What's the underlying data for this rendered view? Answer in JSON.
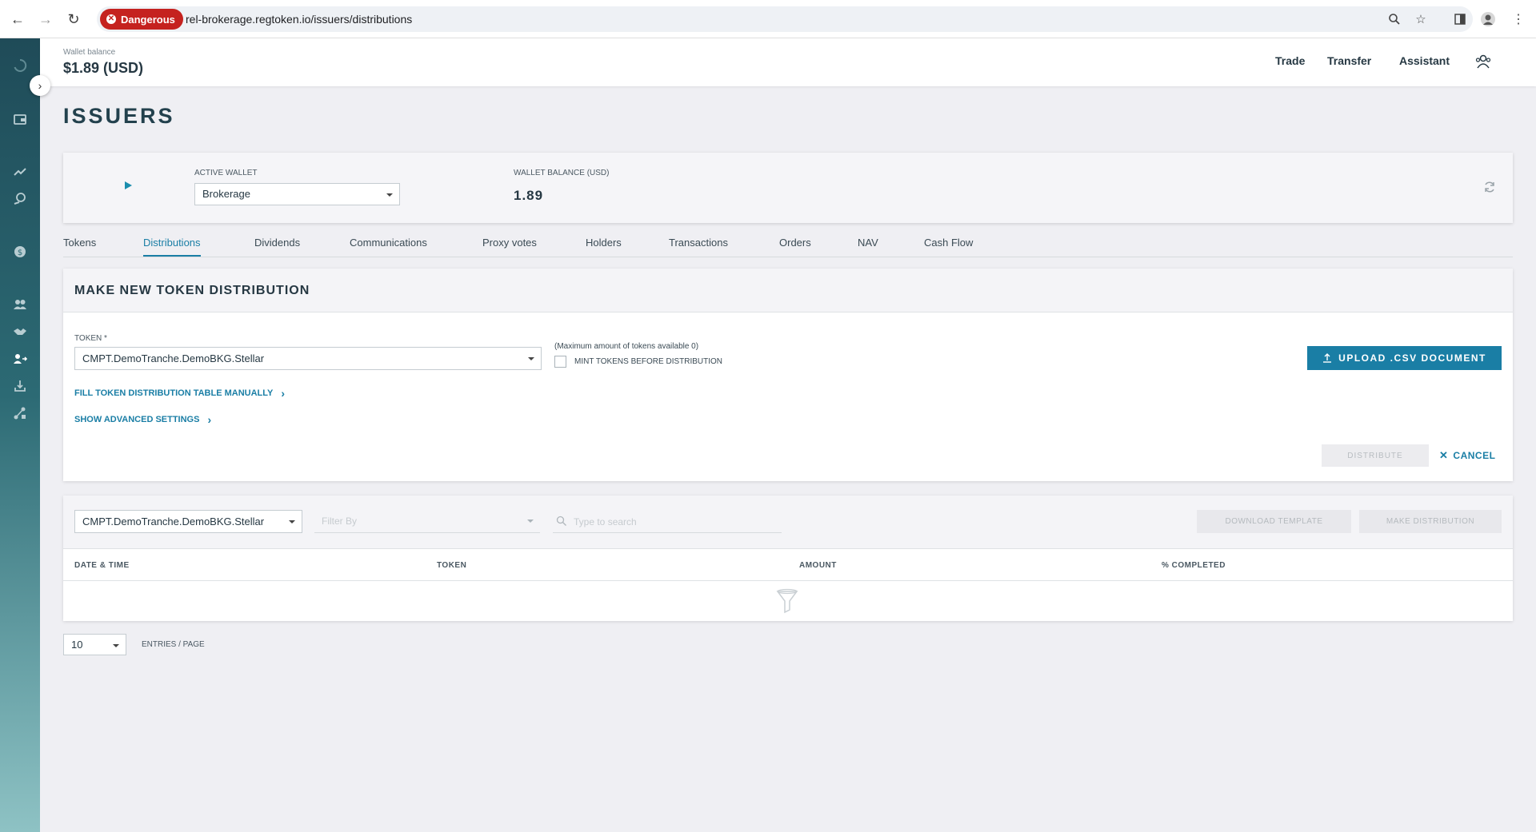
{
  "browser": {
    "security_chip": "Dangerous",
    "url": "rel-brokerage.regtoken.io/issuers/distributions"
  },
  "header": {
    "wallet_balance_label": "Wallet balance",
    "wallet_balance_value": "$1.89 (USD)",
    "links": [
      "Trade",
      "Transfer",
      "Assistant"
    ]
  },
  "page": {
    "title": "ISSUERS"
  },
  "wallet_card": {
    "active_wallet_label": "ACTIVE WALLET",
    "active_wallet_value": "Brokerage",
    "balance_label": "WALLET BALANCE (USD)",
    "balance_value": "1.89"
  },
  "tabs": [
    {
      "label": "Tokens",
      "active": false
    },
    {
      "label": "Distributions",
      "active": true
    },
    {
      "label": "Dividends",
      "active": false
    },
    {
      "label": "Communications",
      "active": false
    },
    {
      "label": "Proxy votes",
      "active": false
    },
    {
      "label": "Holders",
      "active": false
    },
    {
      "label": "Transactions",
      "active": false
    },
    {
      "label": "Orders",
      "active": false
    },
    {
      "label": "NAV",
      "active": false
    },
    {
      "label": "Cash Flow",
      "active": false
    }
  ],
  "distribution_form": {
    "title": "MAKE NEW TOKEN DISTRIBUTION",
    "token_label": "TOKEN *",
    "token_value": "CMPT.DemoTranche.DemoBKG.Stellar",
    "max_note": "(Maximum amount of tokens available 0)",
    "mint_label": "MINT TOKENS BEFORE DISTRIBUTION",
    "mint_checked": false,
    "upload_label": "UPLOAD .CSV DOCUMENT",
    "fill_manual_link": "FILL TOKEN DISTRIBUTION TABLE MANUALLY",
    "advanced_link": "SHOW ADVANCED SETTINGS",
    "distribute_label": "DISTRIBUTE",
    "cancel_label": "CANCEL"
  },
  "table": {
    "token_filter_value": "CMPT.DemoTranche.DemoBKG.Stellar",
    "filter_by_placeholder": "Filter By",
    "search_placeholder": "Type to search",
    "download_template_label": "DOWNLOAD TEMPLATE",
    "make_distribution_label": "MAKE DISTRIBUTION",
    "columns": [
      "DATE & TIME",
      "TOKEN",
      "AMOUNT",
      "% COMPLETED"
    ],
    "rows": []
  },
  "pagination": {
    "page_size": "10",
    "entries_label": "ENTRIES / PAGE"
  },
  "colors": {
    "accent": "#1a7ea5",
    "danger": "#c5221f",
    "sidebar_top": "#1f4b58",
    "sidebar_bottom": "#8ec2c4"
  }
}
